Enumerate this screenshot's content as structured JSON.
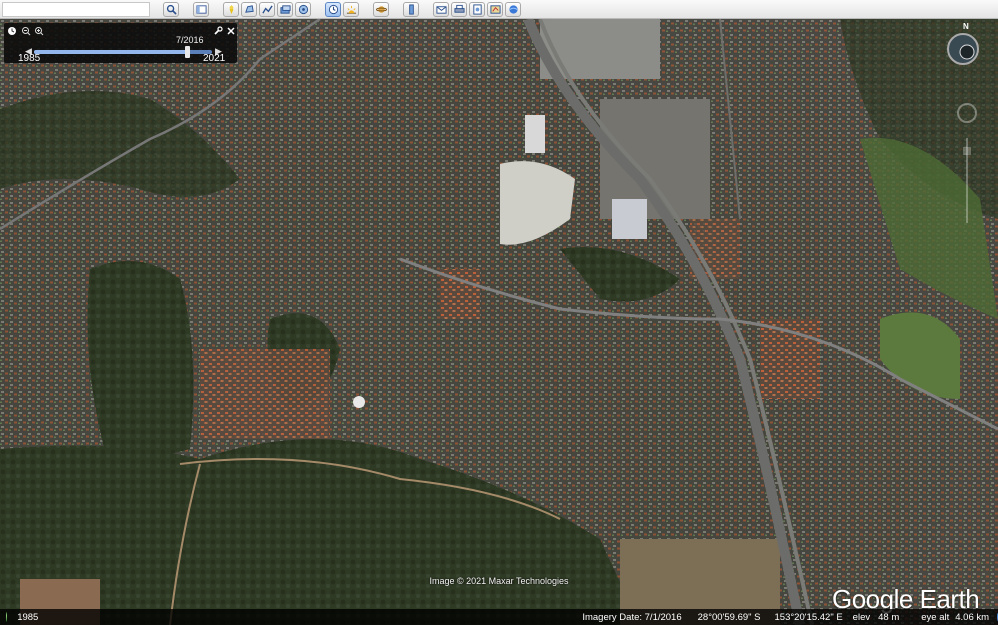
{
  "toolbar": {
    "search_placeholder": "",
    "buttons": [
      "search-icon",
      "sidebar-icon",
      "placemark-icon",
      "polygon-icon",
      "path-icon",
      "overlay-icon",
      "tour-icon",
      "historical-imagery-icon",
      "sun-icon",
      "planets-icon",
      "ruler-icon",
      "email-icon",
      "print-icon",
      "save-image-icon",
      "map-icon",
      "web-icon"
    ]
  },
  "historical": {
    "date": "7/2016",
    "start_year": "1985",
    "end_year": "2021",
    "position_fraction": 0.86
  },
  "nav": {
    "north_label": "N"
  },
  "map": {
    "copyright": "Image © 2021 Maxar Technologies",
    "logo": "Google Earth"
  },
  "status": {
    "year": "1985",
    "imagery_date": "Imagery Date: 7/1/2016",
    "lat": "28°00'59.69\" S",
    "lon": "153°20'15.42\" E",
    "elev_label": "elev",
    "elev_value": "48 m",
    "eye_label": "eye alt",
    "eye_value": "4.06 km"
  }
}
